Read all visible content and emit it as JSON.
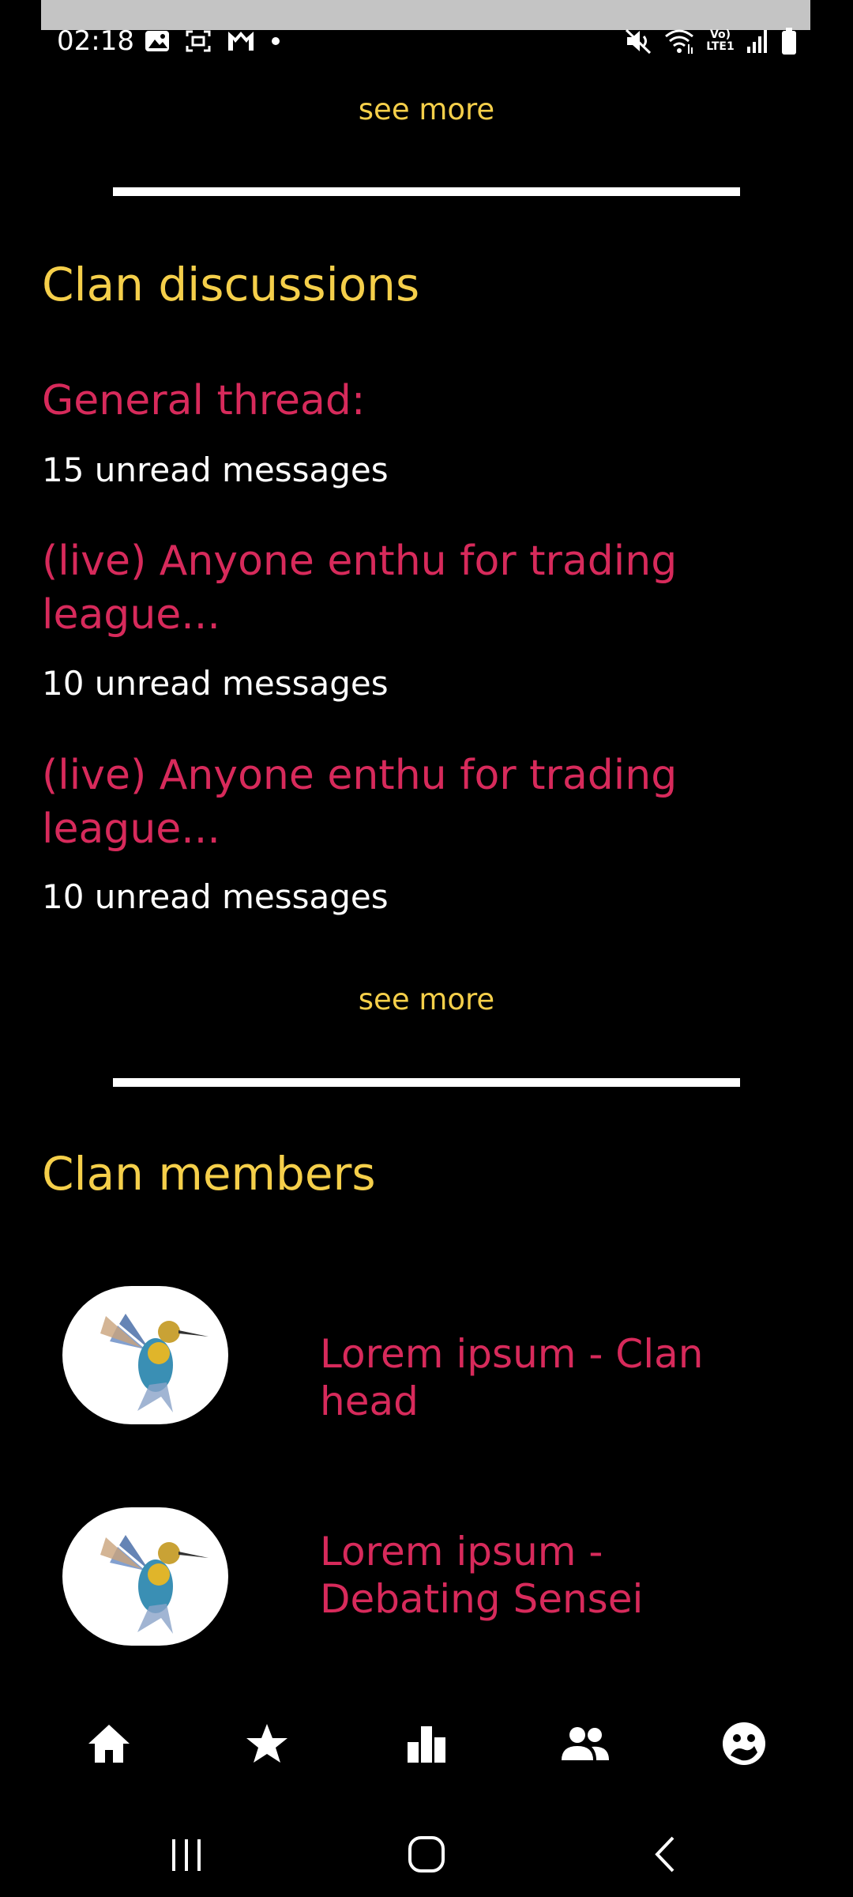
{
  "status_bar": {
    "time": "02:18",
    "icons_left": [
      "gallery-icon",
      "screenshot-icon",
      "m-app-icon",
      "dot-icon"
    ],
    "icons_right": [
      "mute-icon",
      "wifi-icon",
      "volte-lte-icon",
      "signal-icon",
      "battery-icon"
    ],
    "volte_label": "Vo) LTE1"
  },
  "top": {
    "see_more": "see more"
  },
  "discussions": {
    "title": "Clan discussions",
    "threads": [
      {
        "title": "General thread:",
        "count": "15 unread messages"
      },
      {
        "title": "(live) Anyone enthu for trading league...",
        "count": "10 unread messages"
      },
      {
        "title": "(live) Anyone enthu for trading league...",
        "count": "10 unread messages"
      }
    ],
    "see_more": "see more"
  },
  "members": {
    "title": "Clan members",
    "list": [
      {
        "name": "Lorem ipsum - Clan head"
      },
      {
        "name": "Lorem ipsum - Debating Sensei"
      }
    ]
  },
  "bottom_nav": {
    "items": [
      "home-icon",
      "star-icon",
      "leaderboard-icon",
      "people-icon",
      "clan-face-icon"
    ]
  },
  "system_nav": {
    "items": [
      "recents-icon",
      "home-button-icon",
      "back-icon"
    ]
  },
  "colors": {
    "background": "#000000",
    "accent_yellow": "#f5cf4a",
    "accent_pink": "#d72a5b",
    "text": "#ffffff"
  }
}
